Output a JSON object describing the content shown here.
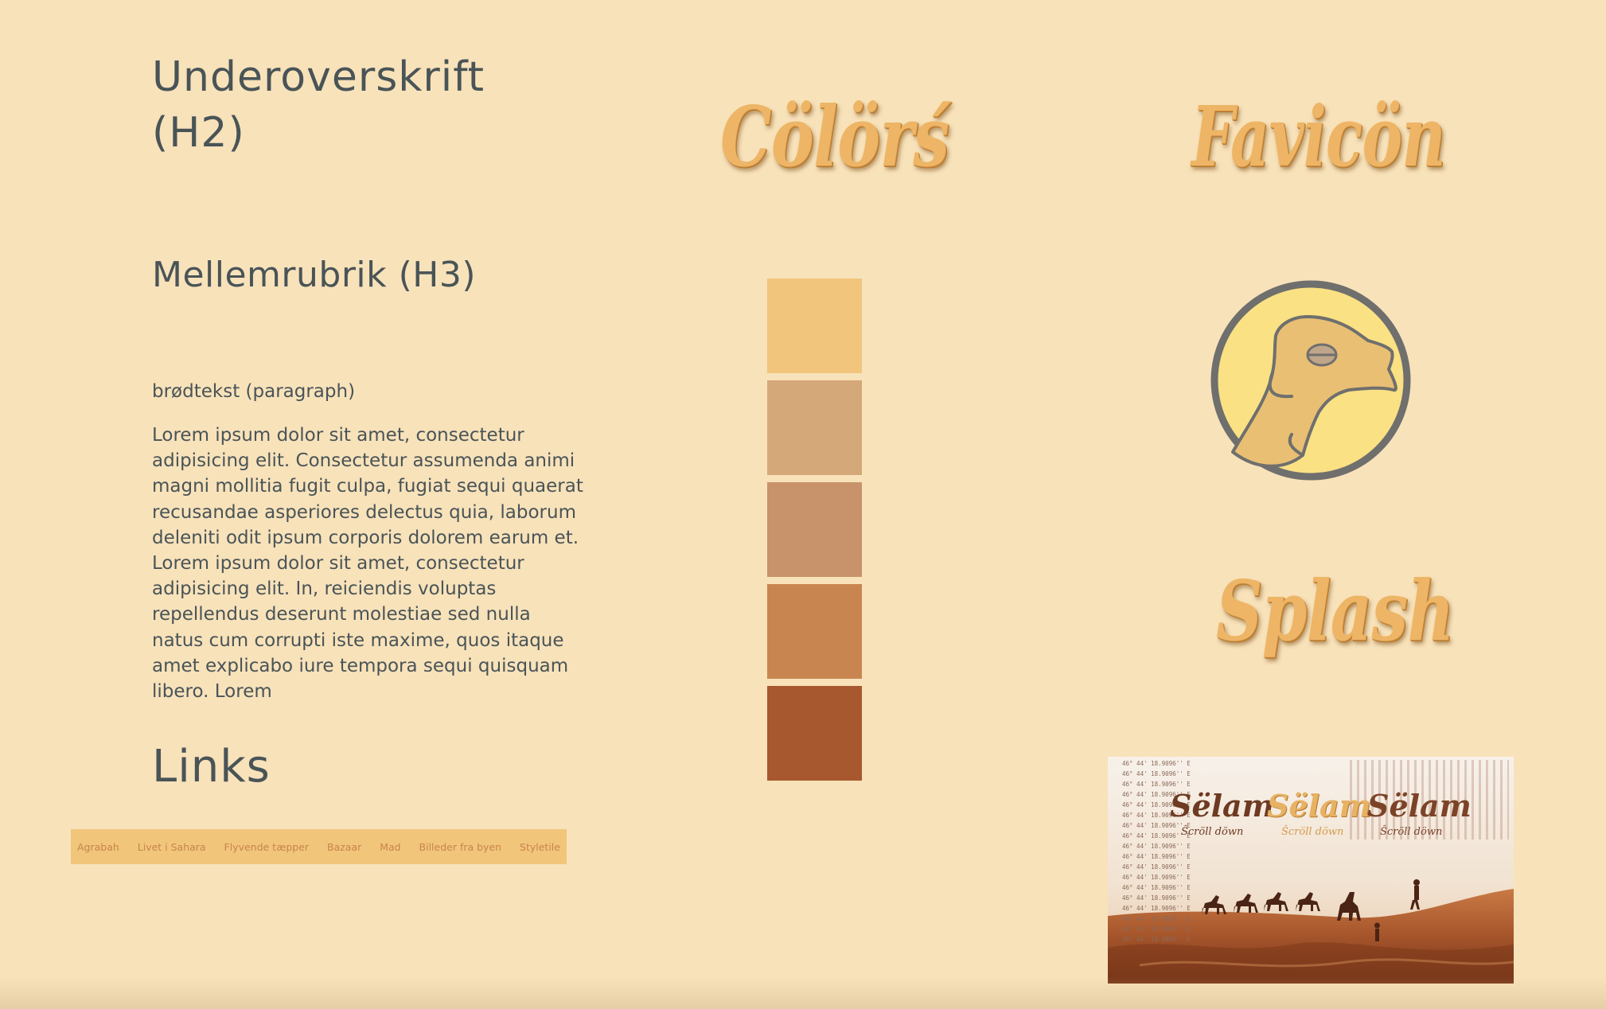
{
  "typography": {
    "h2": "Underoverskrift (H2)",
    "h3": "Mellemrubrik (H3)",
    "paragraph_label": "brødtekst (paragraph)",
    "paragraph_body": "Lorem ipsum dolor sit amet, consectetur adipisicing elit. Consectetur assumenda animi magni mollitia fugit culpa, fugiat sequi quaerat recusandae asperiores delectus quia, laborum deleniti odit ipsum corporis dolorem earum et. Lorem ipsum dolor sit amet, consectetur adipisicing elit. In, reiciendis voluptas repellendus deserunt molestiae sed nulla natus cum corrupti iste maxime, quos itaque amet explicabo iure tempora sequi quisquam libero. Lorem",
    "links_heading": "Links"
  },
  "navbar": {
    "items": [
      "Agrabah",
      "Livet i Sahara",
      "Flyvende tæpper",
      "Bazaar",
      "Mad",
      "Billeder fra byen",
      "Styletile"
    ]
  },
  "sections": {
    "colors_title": "Cölörś",
    "favicon_title": "Favicön",
    "splash_title": "Splash"
  },
  "palette": {
    "swatches": [
      "#f1c57b",
      "#d4a878",
      "#c8936a",
      "#c98550",
      "#a7582f"
    ]
  },
  "favicon": {
    "ring_color": "#6f6f6d",
    "fill_color": "#fae184",
    "camel_color": "#e9bf74"
  },
  "splash_preview": {
    "coordinate_text": "46° 44' 18.9096'' E",
    "logo_text": "Sëlam",
    "scroll_text": "Ŝcröll döwn"
  },
  "colors": {
    "background": "#f8e2ba",
    "text": "#495457",
    "nav_background": "#f1c67b",
    "nav_link": "#c9834d"
  }
}
